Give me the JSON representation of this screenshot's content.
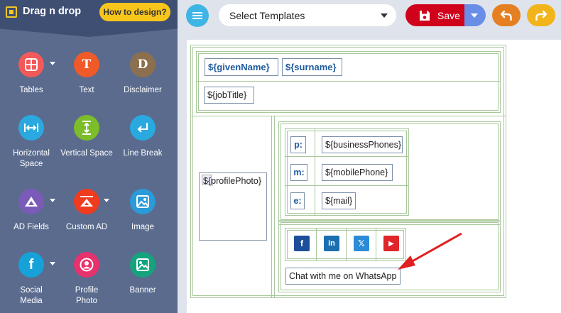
{
  "app": {
    "title": "Drag n drop",
    "how_to_label": "How to design?"
  },
  "sidebar": {
    "tools": [
      {
        "label": "Tables",
        "icon": "table-grid-icon",
        "color": "#f25a5a",
        "has_dropdown": true
      },
      {
        "label": "Text",
        "icon": "text-T-icon",
        "color": "#f05a28",
        "glyph": "T"
      },
      {
        "label": "Disclaimer",
        "icon": "disclaimer-D-icon",
        "color": "#8b6f4e",
        "glyph": "D"
      },
      {
        "label": "Horizontal Space",
        "icon": "horizontal-space-icon",
        "color": "#2aa9e0"
      },
      {
        "label": "Vertical Space",
        "icon": "vertical-space-icon",
        "color": "#7cbd2a"
      },
      {
        "label": "Line Break",
        "icon": "line-break-icon",
        "color": "#2aa9e0"
      },
      {
        "label": "AD Fields",
        "icon": "ad-fields-icon",
        "color": "#7b5bb8",
        "has_dropdown": true
      },
      {
        "label": "Custom AD",
        "icon": "custom-ad-icon",
        "color": "#f03b1f",
        "has_dropdown": true
      },
      {
        "label": "Image",
        "icon": "image-icon",
        "color": "#2a9ad8"
      },
      {
        "label": "Social Media",
        "icon": "facebook-icon",
        "color": "#16a2d9",
        "has_dropdown": true
      },
      {
        "label": "Profile Photo",
        "icon": "profile-photo-icon",
        "color": "#e7326d"
      },
      {
        "label": "Banner",
        "icon": "banner-icon",
        "color": "#15a37e"
      }
    ]
  },
  "toolbar": {
    "template_placeholder": "Select Templates",
    "save_label": "Save",
    "save_color": "#d0021b",
    "undo_icon": "undo-icon",
    "redo_icon": "redo-icon"
  },
  "signature": {
    "given_name": "${givenName}",
    "surname": "${surname}",
    "job_title": "${jobTitle}",
    "profile_photo": "${profilePhoto}",
    "contacts": [
      {
        "label": "p:",
        "value": "${businessPhones}"
      },
      {
        "label": "m:",
        "value": "${mobilePhone}"
      },
      {
        "label": "e:",
        "value": "${mail}"
      }
    ],
    "social": [
      {
        "name": "facebook-icon",
        "glyph": "f",
        "color": "#1b4f9a"
      },
      {
        "name": "linkedin-icon",
        "glyph": "in",
        "color": "#1b6fb0"
      },
      {
        "name": "x-twitter-icon",
        "glyph": "𝕏",
        "color": "#2b8bd8"
      },
      {
        "name": "youtube-icon",
        "glyph": "▶",
        "color": "#e0252b"
      }
    ],
    "whatsapp_text": "Chat with me on WhatsApp"
  }
}
